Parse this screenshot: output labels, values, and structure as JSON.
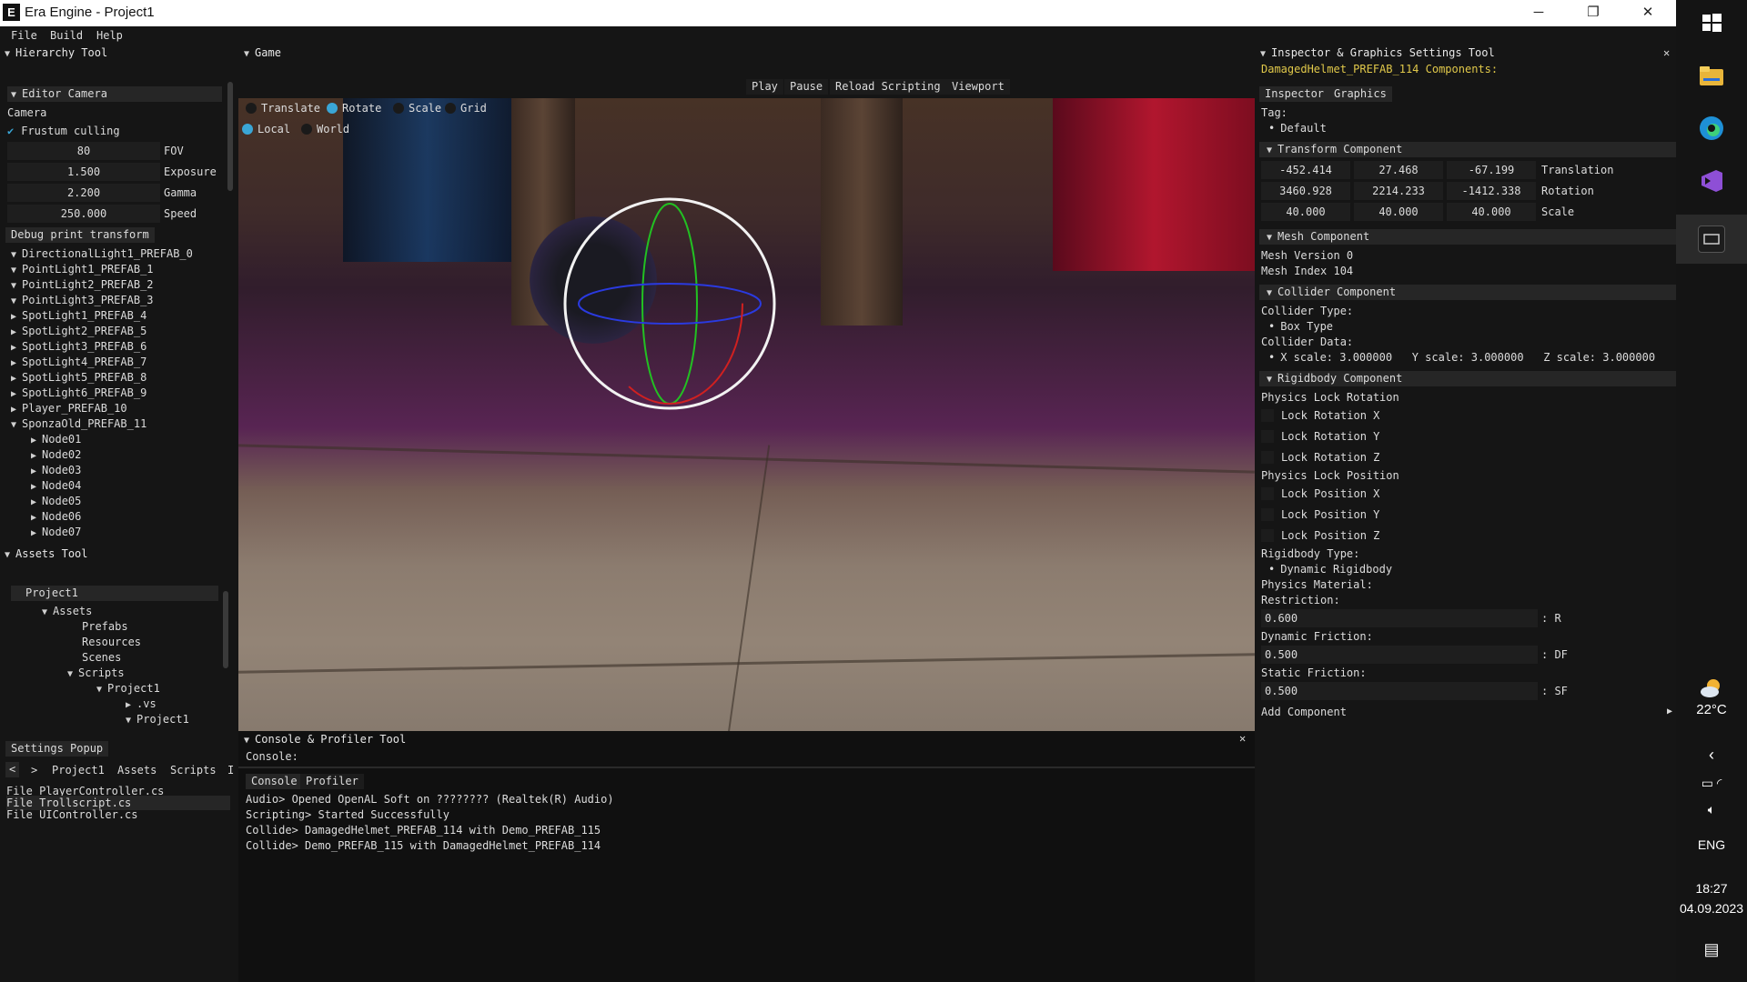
{
  "window": {
    "title": "Era Engine - Project1",
    "logo": "E",
    "minimize": "─",
    "maximize": "❐",
    "close": "✕"
  },
  "menu": [
    "File",
    "Build",
    "Help"
  ],
  "hierarchy": {
    "title": "Hierarchy Tool",
    "editor_camera": "Editor Camera",
    "camera_label": "Camera",
    "frustum": "Frustum culling",
    "fields": [
      {
        "value": "80",
        "label": "FOV"
      },
      {
        "value": "1.500",
        "label": "Exposure"
      },
      {
        "value": "2.200",
        "label": "Gamma"
      },
      {
        "value": "250.000",
        "label": "Speed"
      }
    ],
    "debug_btn": "Debug print transform",
    "items": [
      "DirectionalLight1_PREFAB_0",
      "PointLight1_PREFAB_1",
      "PointLight2_PREFAB_2",
      "PointLight3_PREFAB_3",
      "SpotLight1_PREFAB_4",
      "SpotLight2_PREFAB_5",
      "SpotLight3_PREFAB_6",
      "SpotLight4_PREFAB_7",
      "SpotLight5_PREFAB_8",
      "SpotLight6_PREFAB_9",
      "Player_PREFAB_10",
      "SponzaOld_PREFAB_11"
    ],
    "nodes": [
      "Node01",
      "Node02",
      "Node03",
      "Node04",
      "Node05",
      "Node06",
      "Node07"
    ]
  },
  "assets": {
    "title": "Assets Tool",
    "tree": [
      "Project1",
      "Assets",
      "Prefabs",
      "Resources",
      "Scenes",
      "Scripts",
      "Project1",
      ".vs",
      "Project1"
    ],
    "settings_btn": "Settings Popup",
    "nav": [
      "<",
      ">",
      "Project1",
      "Assets",
      "Scripts",
      "I"
    ],
    "files": [
      "File PlayerController.cs",
      "File Trollscript.cs",
      "File UIController.cs"
    ]
  },
  "game": {
    "title": "Game",
    "toolbar": [
      "Play",
      "Pause",
      "Reload Scripting",
      "Viewport"
    ],
    "gizmo_modes": [
      "Translate",
      "Rotate",
      "Scale",
      "Grid"
    ],
    "space": [
      "Local",
      "World"
    ]
  },
  "console": {
    "title": "Console & Profiler Tool",
    "label": "Console:",
    "tabs": [
      "Console",
      "Profiler"
    ],
    "lines": [
      "Audio> Opened OpenAL Soft on ???????? (Realtek(R) Audio)",
      "Scripting> Started Successfully",
      "Collide> DamagedHelmet_PREFAB_114 with Demo_PREFAB_115",
      "Collide> Demo_PREFAB_115 with DamagedHelmet_PREFAB_114"
    ]
  },
  "inspector": {
    "title": "Inspector & Graphics Settings Tool",
    "entity": "DamagedHelmet_PREFAB_114 Components:",
    "tabs": [
      "Inspector",
      "Graphics"
    ],
    "tag_label": "Tag:",
    "tag_value": "Default",
    "transform": {
      "title": "Transform Component",
      "rows": [
        {
          "values": [
            "-452.414",
            "27.468",
            "-67.199"
          ],
          "label": "Translation"
        },
        {
          "values": [
            "3460.928",
            "2214.233",
            "-1412.338"
          ],
          "label": "Rotation"
        },
        {
          "values": [
            "40.000",
            "40.000",
            "40.000"
          ],
          "label": "Scale"
        }
      ]
    },
    "mesh": {
      "title": "Mesh Component",
      "version": "Mesh Version 0",
      "index": "Mesh Index 104"
    },
    "collider": {
      "title": "Collider Component",
      "type_label": "Collider Type:",
      "type": "Box Type",
      "data_label": "Collider Data:",
      "data": "X scale: 3.000000   Y scale: 3.000000   Z scale: 3.000000"
    },
    "rigidbody": {
      "title": "Rigidbody Component",
      "lock_rot_label": "Physics Lock Rotation",
      "lock_rot": [
        "Lock Rotation X",
        "Lock Rotation Y",
        "Lock Rotation Z"
      ],
      "lock_pos_label": "Physics Lock Position",
      "lock_pos": [
        "Lock Position X",
        "Lock Position Y",
        "Lock Position Z"
      ],
      "type_label": "Rigidbody Type:",
      "type": "Dynamic Rigidbody",
      "material_label": "Physics Material:",
      "restriction_label": "Restriction:",
      "restriction": "0.600",
      "restriction_suffix": ": R",
      "dyn_label": "Dynamic Friction:",
      "dyn": "0.500",
      "dyn_suffix": ": DF",
      "static_label": "Static Friction:",
      "static": "0.500",
      "static_suffix": ": SF"
    },
    "add_component": "Add Component",
    "close": "✕"
  },
  "taskbar": {
    "weather": "22°C",
    "lang": "ENG",
    "time": "18:27",
    "date": "04.09.2023"
  },
  "colors": {
    "accent": "#3aa6d6",
    "entity": "#e0c84a",
    "panel": "#151515"
  }
}
